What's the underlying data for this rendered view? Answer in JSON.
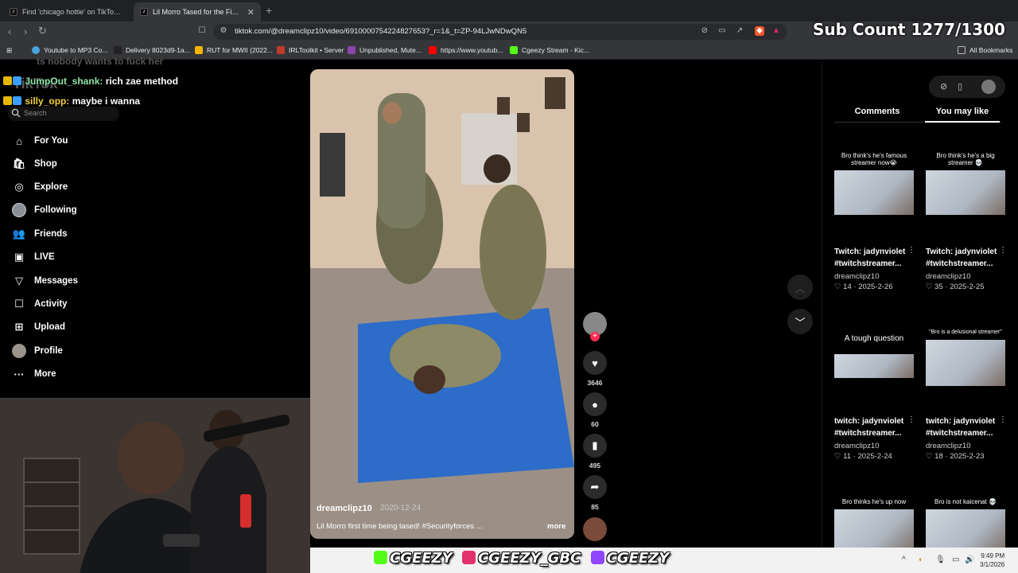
{
  "browser": {
    "tabs": [
      {
        "title": "Find 'chicago hottie' on TikTok | TikTo",
        "active": false
      },
      {
        "title": "Lil Morro Tased for the First Time",
        "active": true
      }
    ],
    "url": "tiktok.com/@dreamclipz10/video/6910000754224827653?_r=1&_t=ZP-94LJwNDwQN5",
    "bookmarks": [
      "Youtube to MP3 Co...",
      "Delivery 8023d9-1a...",
      "RUT for MWII (2022...",
      "IRLToolkit • Server",
      "Unpublished, Mute...",
      "https://www.youtub...",
      "Cgeezy Stream - Kic..."
    ],
    "all_bookmarks": "All Bookmarks"
  },
  "overlay": {
    "sub_count": "Sub Count 1277/1300",
    "chat_faded": "ts nobody wants to fuck her",
    "chat": [
      {
        "user": "JumpOut_shank:",
        "message": "rich zae method",
        "color": "#8fe3a6"
      },
      {
        "user": "silly_opp:",
        "message": "maybe i wanna",
        "color": "#f4d03f"
      }
    ],
    "socials": [
      "CGEEZY",
      "CGEEZY_GBC",
      "CGEEZY"
    ]
  },
  "sidebar": {
    "logo": "TikTok",
    "search_placeholder": "Search",
    "items": [
      {
        "label": "For You",
        "icon": "home-icon"
      },
      {
        "label": "Shop",
        "icon": "shop-icon"
      },
      {
        "label": "Explore",
        "icon": "compass-icon"
      },
      {
        "label": "Following",
        "icon": "following-avatar-icon"
      },
      {
        "label": "Friends",
        "icon": "friends-icon"
      },
      {
        "label": "LIVE",
        "icon": "live-icon"
      },
      {
        "label": "Messages",
        "icon": "messages-icon"
      },
      {
        "label": "Activity",
        "icon": "activity-icon"
      },
      {
        "label": "Upload",
        "icon": "upload-icon"
      },
      {
        "label": "Profile",
        "icon": "profile-avatar-icon"
      },
      {
        "label": "More",
        "icon": "more-icon"
      }
    ]
  },
  "video": {
    "username": "dreamclipz10",
    "date": "2020-12-24",
    "caption": "Lil Morro first time being tased! #Securityforces ...",
    "more": "more",
    "likes": "3646",
    "comments": "60",
    "saves": "495",
    "shares": "85"
  },
  "right_panel": {
    "tabs": [
      "Comments",
      "You may like"
    ],
    "active_tab": "You may like",
    "cards": [
      {
        "thumb_text": "Bro think's he's famous streamer now😭",
        "title": "Twitch: jadynviolet",
        "subtitle": "#twitchstreamer...",
        "user": "dreamclipz10",
        "likes": "14",
        "date": "2025-2-26"
      },
      {
        "thumb_text": "Bro think's he's a big streamer 💀",
        "title": "Twitch: jadynviolet",
        "subtitle": "#twitchstreamer...",
        "user": "dreamclipz10",
        "likes": "35",
        "date": "2025-2-25"
      },
      {
        "thumb_text": "A tough question",
        "title": "twitch: jadynviolet",
        "subtitle": "#twitchstreamer...",
        "user": "dreamclipz10",
        "likes": "11",
        "date": "2025-2-24"
      },
      {
        "thumb_text": "\"Bro is a delusional streamer\"",
        "title": "twitch: jadynviolet",
        "subtitle": "#twitchstreamer...",
        "user": "dreamclipz10",
        "likes": "18",
        "date": "2025-2-23"
      },
      {
        "thumb_text": "Bro thinks he's up now",
        "title": "",
        "subtitle": "",
        "user": "",
        "likes": "",
        "date": ""
      },
      {
        "thumb_text": "Bro is not kaicenat 💀",
        "title": "",
        "subtitle": "",
        "user": "",
        "likes": "",
        "date": ""
      }
    ]
  },
  "taskbar": {
    "time": "9:49 PM",
    "date": "3/1/2026"
  },
  "colors": {
    "accent_red": "#fe2c55",
    "chrome_dark": "#202124",
    "chrome_mid": "#35363a"
  }
}
